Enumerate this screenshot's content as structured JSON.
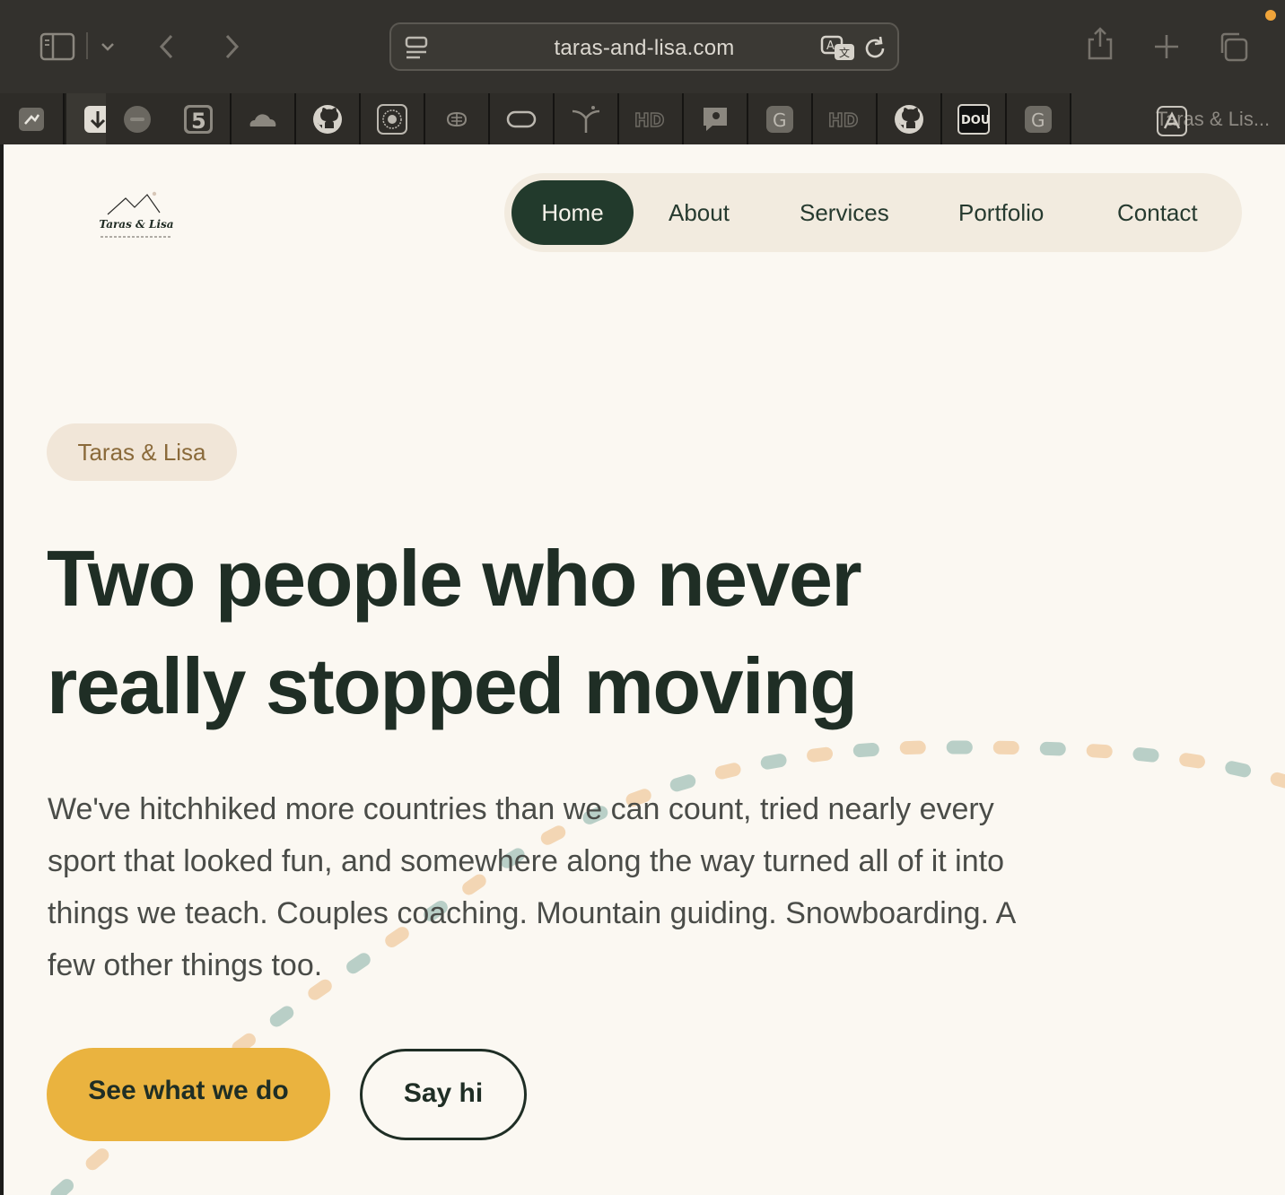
{
  "browser": {
    "url": "taras-and-lisa.com",
    "active_tab_title": "Taras & Lis...",
    "tab_icons": [
      "bookmark-icon",
      "download-icon",
      "circle-extension-icon",
      "five-icon",
      "cloud-icon",
      "github-icon",
      "sun-icon",
      "brain-icon",
      "capsule-icon",
      "branch-icon",
      "hd-icon",
      "chat-icon",
      "g-icon",
      "hd-icon",
      "github-icon",
      "dou-icon",
      "g-icon"
    ],
    "tab_labels": {
      "five": "5",
      "hd1": "HD",
      "g1": "G",
      "hd2": "HD",
      "dou": "DOU",
      "g2": "G"
    }
  },
  "site": {
    "logo_text": "Taras & Lisa",
    "nav": {
      "home": "Home",
      "about": "About",
      "services": "Services",
      "portfolio": "Portfolio",
      "contact": "Contact"
    },
    "hero": {
      "eyebrow": "Taras & Lisa",
      "headline_line1": "Two people who never",
      "headline_line2": "really stopped moving",
      "lede_line1": "We've hitchhiked more countries than we can count, tried nearly every",
      "lede_line2": "sport that looked fun, and somewhere along the way turned all of it into",
      "lede_line3": "things we teach. Couples coaching. Mountain guiding. Snowboarding. A",
      "lede_line4": "few other things too.",
      "primary_cta": "See what we do",
      "secondary_cta": "Say hi"
    }
  },
  "colors": {
    "accent": "#eab33f",
    "dark_green": "#223a2c",
    "trail_teal": "#b9cfc7",
    "trail_peach": "#f3d6b4"
  }
}
